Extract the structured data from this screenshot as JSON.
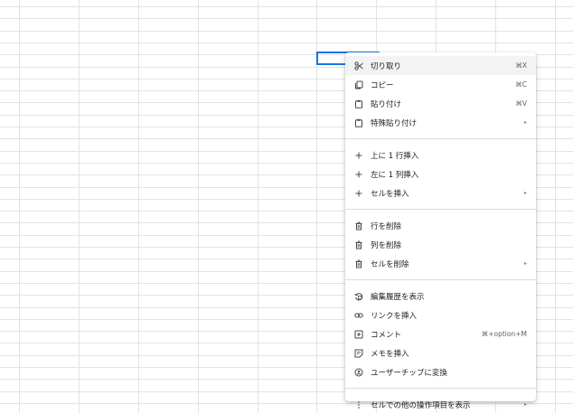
{
  "menu": {
    "groups": [
      [
        {
          "label": "切り取り",
          "shortcut": "⌘X",
          "icon": "scissors-icon"
        },
        {
          "label": "コピー",
          "shortcut": "⌘C",
          "icon": "copy-icon"
        },
        {
          "label": "貼り付け",
          "shortcut": "⌘V",
          "icon": "paste-icon"
        },
        {
          "label": "特殊貼り付け",
          "submenu": "▸",
          "icon": "paste-special-icon"
        }
      ],
      [
        {
          "label": "上に 1 行挿入",
          "icon": "plus-icon"
        },
        {
          "label": "左に 1 列挿入",
          "icon": "plus-icon"
        },
        {
          "label": "セルを挿入",
          "submenu": "▸",
          "icon": "plus-icon"
        }
      ],
      [
        {
          "label": "行を削除",
          "icon": "trash-icon"
        },
        {
          "label": "列を削除",
          "icon": "trash-icon"
        },
        {
          "label": "セルを削除",
          "submenu": "▸",
          "icon": "trash-icon"
        }
      ],
      [
        {
          "label": "編集履歴を表示",
          "icon": "history-icon"
        },
        {
          "label": "リンクを挿入",
          "icon": "link-icon"
        },
        {
          "label": "コメント",
          "shortcut": "⌘+option+M",
          "icon": "comment-icon"
        },
        {
          "label": "メモを挿入",
          "icon": "note-icon"
        },
        {
          "label": "ユーザーチップに変換",
          "icon": "person-chip-icon"
        }
      ],
      [
        {
          "label": "セルでの他の操作項目を表示",
          "submenu": "▸",
          "icon": "more-vert-icon"
        }
      ]
    ]
  },
  "colors": {
    "selection": "#1a73e8",
    "hover": "#f1f3f4",
    "grid": "#e2e3e3"
  }
}
